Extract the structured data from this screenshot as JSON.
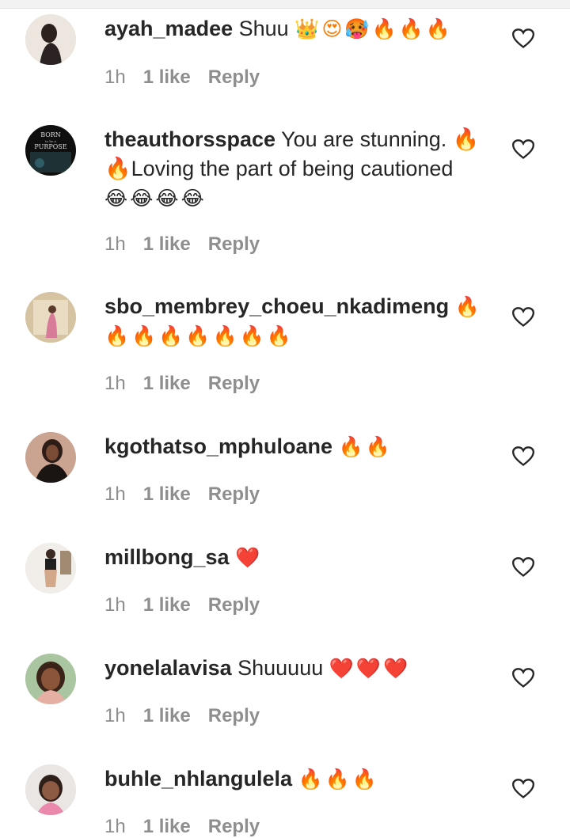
{
  "comments": [
    {
      "username": "ayah_madee",
      "text": "Shuu",
      "emoji": "👑😍🥵🔥🔥🔥",
      "time": "1h",
      "likes": "1 like",
      "reply": "Reply"
    },
    {
      "username": "theauthorsspace",
      "text": "You are stunning. 🔥🔥Loving the part of being cautioned",
      "emoji": "😂😂😂😂",
      "time": "1h",
      "likes": "1 like",
      "reply": "Reply",
      "avatar_text": [
        "BORN",
        "to be a",
        "PURPOSE"
      ]
    },
    {
      "username": "sbo_membrey_choeu_nkadimeng",
      "text": "",
      "emoji": "🔥🔥🔥🔥🔥🔥🔥🔥",
      "time": "1h",
      "likes": "1 like",
      "reply": "Reply"
    },
    {
      "username": "kgothatso_mphuloane",
      "text": "",
      "emoji": "🔥🔥",
      "time": "1h",
      "likes": "1 like",
      "reply": "Reply"
    },
    {
      "username": "millbong_sa",
      "text": "",
      "emoji": "❤️",
      "time": "1h",
      "likes": "1 like",
      "reply": "Reply"
    },
    {
      "username": "yonelalavisa",
      "text": "Shuuuuu",
      "emoji": "❤️❤️❤️",
      "time": "1h",
      "likes": "1 like",
      "reply": "Reply"
    },
    {
      "username": "buhle_nhlangulela",
      "text": "",
      "emoji": "🔥🔥🔥",
      "time": "1h",
      "likes": "1 like",
      "reply": "Reply"
    }
  ],
  "colors": {
    "text": "#262626",
    "meta": "#8e8e8e",
    "fire": "#ff7a00",
    "heart": "#e0162b"
  },
  "icons": {
    "like": "heart-outline-icon"
  }
}
